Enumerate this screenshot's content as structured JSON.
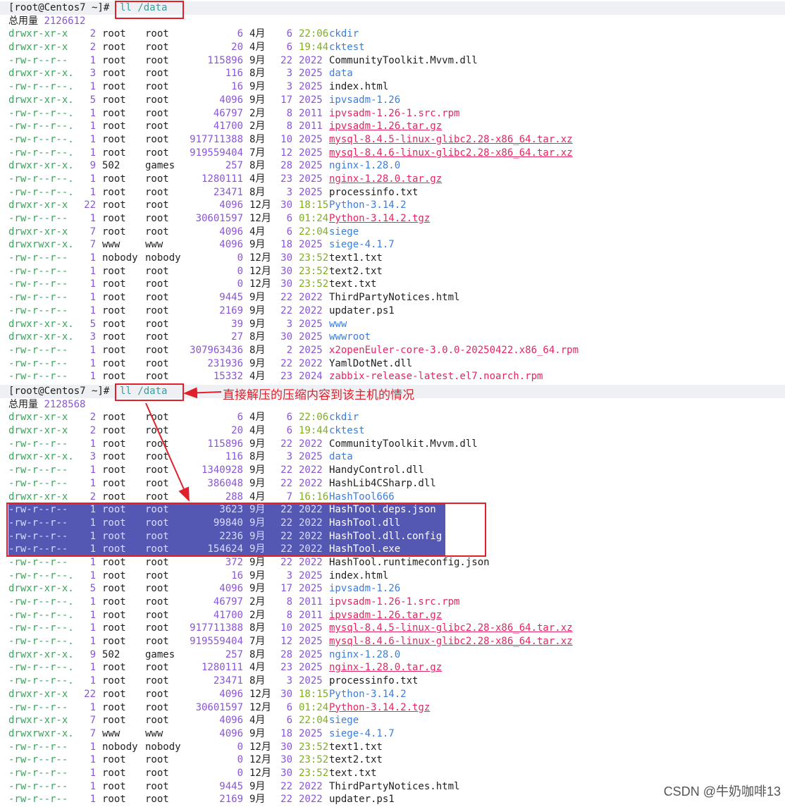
{
  "annotation": {
    "text": "直接解压的压缩内容到该主机的情况"
  },
  "watermark": "CSDN @牛奶咖啡13",
  "sessions": [
    {
      "prompt": "[root@Centos7 ~]#",
      "command": "ll /data",
      "total_label": "总用量",
      "total_value": "2126612",
      "files": [
        {
          "perm": "drwxr-xr-x",
          "links": "2",
          "owner": "root",
          "group": "root",
          "size": "6",
          "month": "4月",
          "day": "6",
          "time": "22:06",
          "name": "ckdir",
          "kind": "dir"
        },
        {
          "perm": "drwxr-xr-x",
          "links": "2",
          "owner": "root",
          "group": "root",
          "size": "20",
          "month": "4月",
          "day": "6",
          "time": "19:44",
          "name": "cktest",
          "kind": "dir"
        },
        {
          "perm": "-rw-r--r--",
          "links": "1",
          "owner": "root",
          "group": "root",
          "size": "115896",
          "month": "9月",
          "day": "22",
          "time": "2022",
          "name": "CommunityToolkit.Mvvm.dll",
          "kind": "plain"
        },
        {
          "perm": "drwxr-xr-x.",
          "links": "3",
          "owner": "root",
          "group": "root",
          "size": "116",
          "month": "8月",
          "day": "3",
          "time": "2025",
          "name": "data",
          "kind": "dir"
        },
        {
          "perm": "-rw-r--r--.",
          "links": "1",
          "owner": "root",
          "group": "root",
          "size": "16",
          "month": "9月",
          "day": "3",
          "time": "2025",
          "name": "index.html",
          "kind": "plain"
        },
        {
          "perm": "drwxr-xr-x.",
          "links": "5",
          "owner": "root",
          "group": "root",
          "size": "4096",
          "month": "9月",
          "day": "17",
          "time": "2025",
          "name": "ipvsadm-1.26",
          "kind": "dir"
        },
        {
          "perm": "-rw-r--r--.",
          "links": "1",
          "owner": "root",
          "group": "root",
          "size": "46797",
          "month": "2月",
          "day": "8",
          "time": "2011",
          "name": "ipvsadm-1.26-1.src.rpm",
          "kind": "pkg"
        },
        {
          "perm": "-rw-r--r--.",
          "links": "1",
          "owner": "root",
          "group": "root",
          "size": "41700",
          "month": "2月",
          "day": "8",
          "time": "2011",
          "name": "ipvsadm-1.26.tar.gz",
          "kind": "arch"
        },
        {
          "perm": "-rw-r--r--.",
          "links": "1",
          "owner": "root",
          "group": "root",
          "size": "917711388",
          "month": "8月",
          "day": "10",
          "time": "2025",
          "name": "mysql-8.4.5-linux-glibc2.28-x86_64.tar.xz",
          "kind": "arch"
        },
        {
          "perm": "-rw-r--r--.",
          "links": "1",
          "owner": "root",
          "group": "root",
          "size": "919559404",
          "month": "7月",
          "day": "12",
          "time": "2025",
          "name": "mysql-8.4.6-linux-glibc2.28-x86_64.tar.xz",
          "kind": "arch"
        },
        {
          "perm": "drwxr-xr-x.",
          "links": "9",
          "owner": "502",
          "group": "games",
          "size": "257",
          "month": "8月",
          "day": "28",
          "time": "2025",
          "name": "nginx-1.28.0",
          "kind": "dir"
        },
        {
          "perm": "-rw-r--r--.",
          "links": "1",
          "owner": "root",
          "group": "root",
          "size": "1280111",
          "month": "4月",
          "day": "23",
          "time": "2025",
          "name": "nginx-1.28.0.tar.gz",
          "kind": "arch"
        },
        {
          "perm": "-rw-r--r--.",
          "links": "1",
          "owner": "root",
          "group": "root",
          "size": "23471",
          "month": "8月",
          "day": "3",
          "time": "2025",
          "name": "processinfo.txt",
          "kind": "plain"
        },
        {
          "perm": "drwxr-xr-x",
          "links": "22",
          "owner": "root",
          "group": "root",
          "size": "4096",
          "month": "12月",
          "day": "30",
          "time": "18:15",
          "name": "Python-3.14.2",
          "kind": "dir"
        },
        {
          "perm": "-rw-r--r--",
          "links": "1",
          "owner": "root",
          "group": "root",
          "size": "30601597",
          "month": "12月",
          "day": "6",
          "time": "01:24",
          "name": "Python-3.14.2.tgz",
          "kind": "arch"
        },
        {
          "perm": "drwxr-xr-x",
          "links": "7",
          "owner": "root",
          "group": "root",
          "size": "4096",
          "month": "4月",
          "day": "6",
          "time": "22:04",
          "name": "siege",
          "kind": "dir"
        },
        {
          "perm": "drwxrwxr-x.",
          "links": "7",
          "owner": "www",
          "group": "www",
          "size": "4096",
          "month": "9月",
          "day": "18",
          "time": "2025",
          "name": "siege-4.1.7",
          "kind": "dir"
        },
        {
          "perm": "-rw-r--r--",
          "links": "1",
          "owner": "nobody",
          "group": "nobody",
          "size": "0",
          "month": "12月",
          "day": "30",
          "time": "23:52",
          "name": "text1.txt",
          "kind": "plain"
        },
        {
          "perm": "-rw-r--r--",
          "links": "1",
          "owner": "root",
          "group": "root",
          "size": "0",
          "month": "12月",
          "day": "30",
          "time": "23:52",
          "name": "text2.txt",
          "kind": "plain"
        },
        {
          "perm": "-rw-r--r--",
          "links": "1",
          "owner": "root",
          "group": "root",
          "size": "0",
          "month": "12月",
          "day": "30",
          "time": "23:52",
          "name": "text.txt",
          "kind": "plain"
        },
        {
          "perm": "-rw-r--r--",
          "links": "1",
          "owner": "root",
          "group": "root",
          "size": "9445",
          "month": "9月",
          "day": "22",
          "time": "2022",
          "name": "ThirdPartyNotices.html",
          "kind": "plain"
        },
        {
          "perm": "-rw-r--r--",
          "links": "1",
          "owner": "root",
          "group": "root",
          "size": "2169",
          "month": "9月",
          "day": "22",
          "time": "2022",
          "name": "updater.ps1",
          "kind": "plain"
        },
        {
          "perm": "drwxr-xr-x.",
          "links": "5",
          "owner": "root",
          "group": "root",
          "size": "39",
          "month": "9月",
          "day": "3",
          "time": "2025",
          "name": "www",
          "kind": "dir"
        },
        {
          "perm": "drwxr-xr-x.",
          "links": "3",
          "owner": "root",
          "group": "root",
          "size": "27",
          "month": "8月",
          "day": "30",
          "time": "2025",
          "name": "wwwroot",
          "kind": "dir"
        },
        {
          "perm": "-rw-r--r--",
          "links": "1",
          "owner": "root",
          "group": "root",
          "size": "307963436",
          "month": "8月",
          "day": "2",
          "time": "2025",
          "name": "x2openEuler-core-3.0.0-20250422.x86_64.rpm",
          "kind": "pkg"
        },
        {
          "perm": "-rw-r--r--",
          "links": "1",
          "owner": "root",
          "group": "root",
          "size": "231936",
          "month": "9月",
          "day": "22",
          "time": "2022",
          "name": "YamlDotNet.dll",
          "kind": "plain"
        },
        {
          "perm": "-rw-r--r--",
          "links": "1",
          "owner": "root",
          "group": "root",
          "size": "15332",
          "month": "4月",
          "day": "23",
          "time": "2024",
          "name": "zabbix-release-latest.el7.noarch.rpm",
          "kind": "pkg"
        }
      ]
    },
    {
      "prompt": "[root@Centos7 ~]#",
      "command": "ll /data",
      "total_label": "总用量",
      "total_value": "2128568",
      "files": [
        {
          "perm": "drwxr-xr-x",
          "links": "2",
          "owner": "root",
          "group": "root",
          "size": "6",
          "month": "4月",
          "day": "6",
          "time": "22:06",
          "name": "ckdir",
          "kind": "dir"
        },
        {
          "perm": "drwxr-xr-x",
          "links": "2",
          "owner": "root",
          "group": "root",
          "size": "20",
          "month": "4月",
          "day": "6",
          "time": "19:44",
          "name": "cktest",
          "kind": "dir"
        },
        {
          "perm": "-rw-r--r--",
          "links": "1",
          "owner": "root",
          "group": "root",
          "size": "115896",
          "month": "9月",
          "day": "22",
          "time": "2022",
          "name": "CommunityToolkit.Mvvm.dll",
          "kind": "plain"
        },
        {
          "perm": "drwxr-xr-x.",
          "links": "3",
          "owner": "root",
          "group": "root",
          "size": "116",
          "month": "8月",
          "day": "3",
          "time": "2025",
          "name": "data",
          "kind": "dir"
        },
        {
          "perm": "-rw-r--r--",
          "links": "1",
          "owner": "root",
          "group": "root",
          "size": "1340928",
          "month": "9月",
          "day": "22",
          "time": "2022",
          "name": "HandyControl.dll",
          "kind": "plain"
        },
        {
          "perm": "-rw-r--r--",
          "links": "1",
          "owner": "root",
          "group": "root",
          "size": "386048",
          "month": "9月",
          "day": "22",
          "time": "2022",
          "name": "HashLib4CSharp.dll",
          "kind": "plain"
        },
        {
          "perm": "drwxr-xr-x",
          "links": "2",
          "owner": "root",
          "group": "root",
          "size": "288",
          "month": "4月",
          "day": "7",
          "time": "16:16",
          "name": "HashTool666",
          "kind": "dir"
        },
        {
          "perm": "-rw-r--r--",
          "links": "1",
          "owner": "root",
          "group": "root",
          "size": "3623",
          "month": "9月",
          "day": "22",
          "time": "2022",
          "name": "HashTool.deps.json",
          "kind": "plain",
          "selected": true
        },
        {
          "perm": "-rw-r--r--",
          "links": "1",
          "owner": "root",
          "group": "root",
          "size": "99840",
          "month": "9月",
          "day": "22",
          "time": "2022",
          "name": "HashTool.dll",
          "kind": "plain",
          "selected": true
        },
        {
          "perm": "-rw-r--r--",
          "links": "1",
          "owner": "root",
          "group": "root",
          "size": "2236",
          "month": "9月",
          "day": "22",
          "time": "2022",
          "name": "HashTool.dll.config",
          "kind": "plain",
          "selected": true
        },
        {
          "perm": "-rw-r--r--",
          "links": "1",
          "owner": "root",
          "group": "root",
          "size": "154624",
          "month": "9月",
          "day": "22",
          "time": "2022",
          "name": "HashTool.exe",
          "kind": "plain",
          "selected": true
        },
        {
          "perm": "-rw-r--r--",
          "links": "1",
          "owner": "root",
          "group": "root",
          "size": "372",
          "month": "9月",
          "day": "22",
          "time": "2022",
          "name": "HashTool.runtimeconfig.json",
          "kind": "plain"
        },
        {
          "perm": "-rw-r--r--.",
          "links": "1",
          "owner": "root",
          "group": "root",
          "size": "16",
          "month": "9月",
          "day": "3",
          "time": "2025",
          "name": "index.html",
          "kind": "plain"
        },
        {
          "perm": "drwxr-xr-x.",
          "links": "5",
          "owner": "root",
          "group": "root",
          "size": "4096",
          "month": "9月",
          "day": "17",
          "time": "2025",
          "name": "ipvsadm-1.26",
          "kind": "dir"
        },
        {
          "perm": "-rw-r--r--.",
          "links": "1",
          "owner": "root",
          "group": "root",
          "size": "46797",
          "month": "2月",
          "day": "8",
          "time": "2011",
          "name": "ipvsadm-1.26-1.src.rpm",
          "kind": "pkg"
        },
        {
          "perm": "-rw-r--r--.",
          "links": "1",
          "owner": "root",
          "group": "root",
          "size": "41700",
          "month": "2月",
          "day": "8",
          "time": "2011",
          "name": "ipvsadm-1.26.tar.gz",
          "kind": "arch"
        },
        {
          "perm": "-rw-r--r--.",
          "links": "1",
          "owner": "root",
          "group": "root",
          "size": "917711388",
          "month": "8月",
          "day": "10",
          "time": "2025",
          "name": "mysql-8.4.5-linux-glibc2.28-x86_64.tar.xz",
          "kind": "arch"
        },
        {
          "perm": "-rw-r--r--.",
          "links": "1",
          "owner": "root",
          "group": "root",
          "size": "919559404",
          "month": "7月",
          "day": "12",
          "time": "2025",
          "name": "mysql-8.4.6-linux-glibc2.28-x86_64.tar.xz",
          "kind": "arch"
        },
        {
          "perm": "drwxr-xr-x.",
          "links": "9",
          "owner": "502",
          "group": "games",
          "size": "257",
          "month": "8月",
          "day": "28",
          "time": "2025",
          "name": "nginx-1.28.0",
          "kind": "dir"
        },
        {
          "perm": "-rw-r--r--.",
          "links": "1",
          "owner": "root",
          "group": "root",
          "size": "1280111",
          "month": "4月",
          "day": "23",
          "time": "2025",
          "name": "nginx-1.28.0.tar.gz",
          "kind": "arch"
        },
        {
          "perm": "-rw-r--r--.",
          "links": "1",
          "owner": "root",
          "group": "root",
          "size": "23471",
          "month": "8月",
          "day": "3",
          "time": "2025",
          "name": "processinfo.txt",
          "kind": "plain"
        },
        {
          "perm": "drwxr-xr-x",
          "links": "22",
          "owner": "root",
          "group": "root",
          "size": "4096",
          "month": "12月",
          "day": "30",
          "time": "18:15",
          "name": "Python-3.14.2",
          "kind": "dir"
        },
        {
          "perm": "-rw-r--r--",
          "links": "1",
          "owner": "root",
          "group": "root",
          "size": "30601597",
          "month": "12月",
          "day": "6",
          "time": "01:24",
          "name": "Python-3.14.2.tgz",
          "kind": "arch"
        },
        {
          "perm": "drwxr-xr-x",
          "links": "7",
          "owner": "root",
          "group": "root",
          "size": "4096",
          "month": "4月",
          "day": "6",
          "time": "22:04",
          "name": "siege",
          "kind": "dir"
        },
        {
          "perm": "drwxrwxr-x.",
          "links": "7",
          "owner": "www",
          "group": "www",
          "size": "4096",
          "month": "9月",
          "day": "18",
          "time": "2025",
          "name": "siege-4.1.7",
          "kind": "dir"
        },
        {
          "perm": "-rw-r--r--",
          "links": "1",
          "owner": "nobody",
          "group": "nobody",
          "size": "0",
          "month": "12月",
          "day": "30",
          "time": "23:52",
          "name": "text1.txt",
          "kind": "plain"
        },
        {
          "perm": "-rw-r--r--",
          "links": "1",
          "owner": "root",
          "group": "root",
          "size": "0",
          "month": "12月",
          "day": "30",
          "time": "23:52",
          "name": "text2.txt",
          "kind": "plain"
        },
        {
          "perm": "-rw-r--r--",
          "links": "1",
          "owner": "root",
          "group": "root",
          "size": "0",
          "month": "12月",
          "day": "30",
          "time": "23:52",
          "name": "text.txt",
          "kind": "plain"
        },
        {
          "perm": "-rw-r--r--",
          "links": "1",
          "owner": "root",
          "group": "root",
          "size": "9445",
          "month": "9月",
          "day": "22",
          "time": "2022",
          "name": "ThirdPartyNotices.html",
          "kind": "plain"
        },
        {
          "perm": "-rw-r--r--",
          "links": "1",
          "owner": "root",
          "group": "root",
          "size": "2169",
          "month": "9月",
          "day": "22",
          "time": "2022",
          "name": "updater.ps1",
          "kind": "plain"
        }
      ]
    }
  ]
}
